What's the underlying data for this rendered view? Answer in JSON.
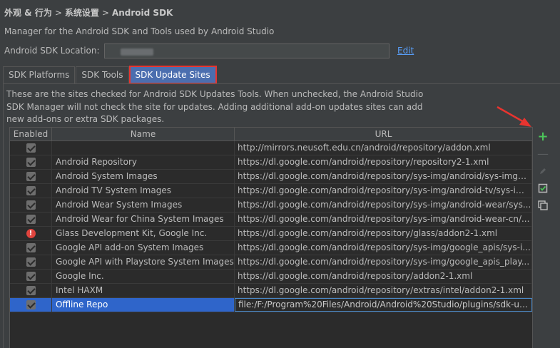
{
  "breadcrumb": {
    "items": [
      "外观 & 行为",
      "系统设置",
      "Android SDK"
    ],
    "separator": ">"
  },
  "description": "Manager for the Android SDK and Tools used by Android Studio",
  "sdk_location": {
    "label": "Android SDK Location:",
    "edit_label": "Edit"
  },
  "tabs": [
    {
      "label": "SDK Platforms",
      "active": false
    },
    {
      "label": "SDK Tools",
      "active": false
    },
    {
      "label": "SDK Update Sites",
      "active": true
    }
  ],
  "info_text": "These are the sites checked for Android SDK Updates Tools. When unchecked, the Android Studio SDK Manager will not check the site for updates. Adding additional add-on updates sites can add new add-ons or extra SDK packages.",
  "table": {
    "headers": {
      "enabled": "Enabled",
      "name": "Name",
      "url": "URL"
    },
    "rows": [
      {
        "status": "checked",
        "name": "",
        "url": "http://mirrors.neusoft.edu.cn/android/repository/addon.xml"
      },
      {
        "status": "checked",
        "name": "Android Repository",
        "url": "https://dl.google.com/android/repository/repository2-1.xml"
      },
      {
        "status": "checked",
        "name": "Android System Images",
        "url": "https://dl.google.com/android/repository/sys-img/android/sys-img2..."
      },
      {
        "status": "checked",
        "name": "Android TV System Images",
        "url": "https://dl.google.com/android/repository/sys-img/android-tv/sys-im..."
      },
      {
        "status": "checked",
        "name": "Android Wear System Images",
        "url": "https://dl.google.com/android/repository/sys-img/android-wear/sys..."
      },
      {
        "status": "checked",
        "name": "Android Wear for China System Images",
        "url": "https://dl.google.com/android/repository/sys-img/android-wear-cn/..."
      },
      {
        "status": "error",
        "name": "Glass Development Kit, Google Inc.",
        "url": "https://dl.google.com/android/repository/glass/addon2-1.xml"
      },
      {
        "status": "checked",
        "name": "Google API add-on System Images",
        "url": "https://dl.google.com/android/repository/sys-img/google_apis/sys-i..."
      },
      {
        "status": "checked",
        "name": "Google API with Playstore System Images",
        "url": "https://dl.google.com/android/repository/sys-img/google_apis_play..."
      },
      {
        "status": "checked",
        "name": "Google Inc.",
        "url": "https://dl.google.com/android/repository/addon2-1.xml"
      },
      {
        "status": "checked",
        "name": "Intel HAXM",
        "url": "https://dl.google.com/android/repository/extras/intel/addon2-1.xml"
      },
      {
        "status": "checked",
        "name": "Offline Repo",
        "url": "file:/F:/Program%20Files/Android/Android%20Studio/plugins/sdk-up...",
        "selected": true
      }
    ]
  },
  "toolbar": {
    "icons": [
      "plus-icon",
      "minus-icon",
      "pencil-icon",
      "check-all-icon",
      "copy-icon"
    ]
  },
  "colors": {
    "background": "#3c3f41",
    "table_bg": "#2b2b2b",
    "selection": "#2f65ca",
    "link": "#589df6",
    "add_green": "#4cc65a",
    "annotation_red": "#e8342f"
  }
}
